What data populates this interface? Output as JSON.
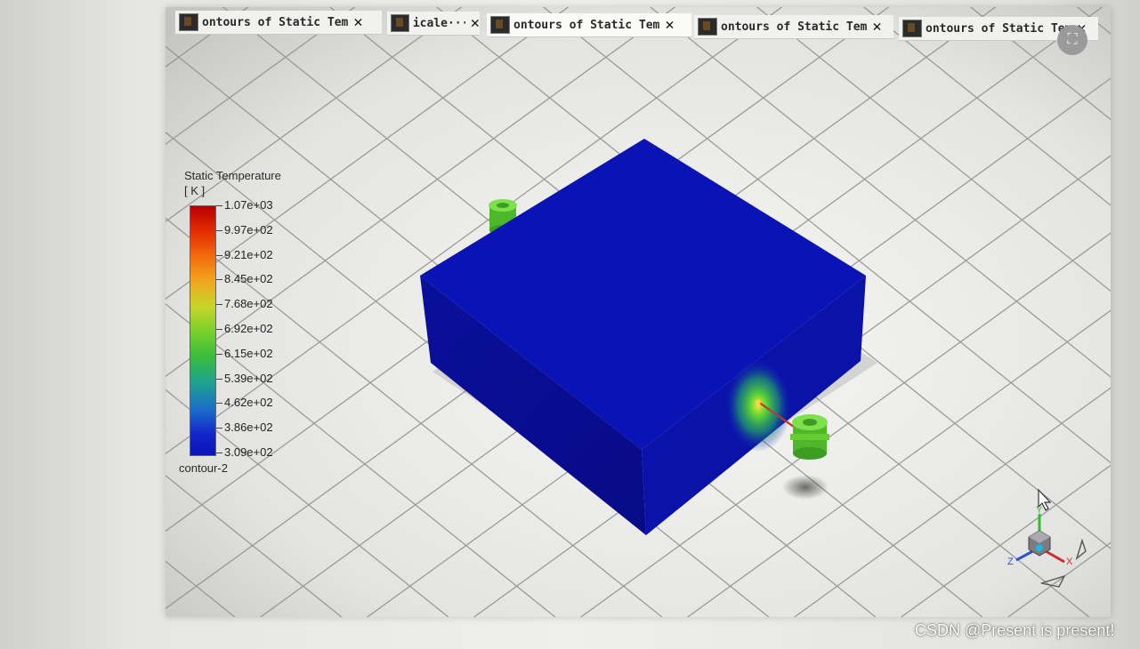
{
  "tabs": [
    {
      "label": "ontours of Static Tem",
      "active": false
    },
    {
      "label": "icale···",
      "active": false
    },
    {
      "label": "ontours of Static Tem",
      "active": true
    },
    {
      "label": "ontours of Static Tem",
      "active": false
    },
    {
      "label": "ontours of Static Tem",
      "active": false
    }
  ],
  "legend": {
    "title": "Static Temperature",
    "unit": "[ K ]",
    "labels": [
      "1.07e+03",
      "9.97e+02",
      "9.21e+02",
      "8.45e+02",
      "7.68e+02",
      "6.92e+02",
      "6.15e+02",
      "5.39e+02",
      "4.62e+02",
      "3.86e+02",
      "3.09e+02"
    ],
    "name": "contour-2"
  },
  "axes": {
    "x": "X",
    "y": "Y",
    "z": "Z"
  },
  "watermark": "CSDN @Present is present!",
  "colors": {
    "block": "#0a12b6",
    "hotspot": "#5bd236",
    "inlet": "#5ccc2a"
  }
}
